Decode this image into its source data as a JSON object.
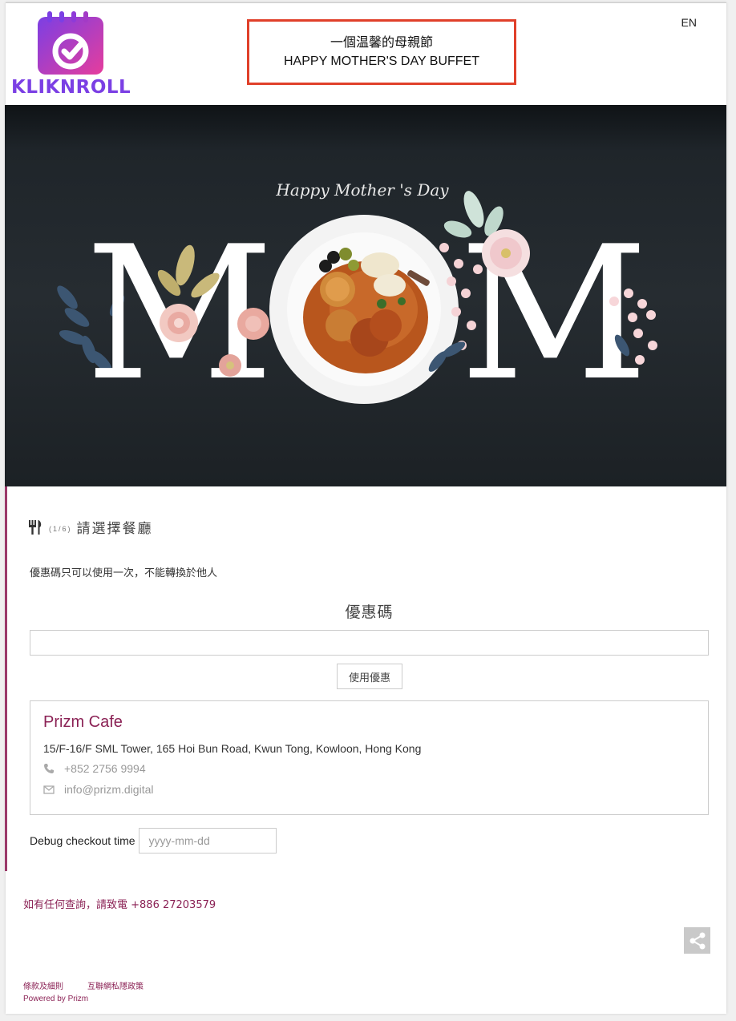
{
  "header": {
    "brand": "KLIKNROLL",
    "lang_toggle": "EN",
    "title_zh": "一個温馨的母親節",
    "title_en": "HAPPY MOTHER'S DAY BUFFET"
  },
  "banner": {
    "script_text": "Happy Mother 's Day",
    "letters": [
      "M",
      "M"
    ]
  },
  "step": {
    "counter": "(1/6)",
    "label": "請選擇餐廳"
  },
  "coupon": {
    "note": "優惠碼只可以使用一次，不能轉換於他人",
    "title": "優惠碼",
    "input_value": "",
    "apply_label": "使用優惠"
  },
  "restaurant": {
    "name": "Prizm Cafe",
    "address": "15/F-16/F SML Tower, 165 Hoi Bun Road, Kwun Tong, Kowloon, Hong Kong",
    "phone": "+852 2756 9994",
    "email": "info@prizm.digital"
  },
  "debug": {
    "label": "Debug checkout time",
    "placeholder": "yyyy-mm-dd"
  },
  "footer": {
    "contact": "如有任何查詢，請致電 +886 27203579",
    "terms": "條款及細則",
    "privacy": "互聯網私隱政策",
    "powered": "Powered by Prizm"
  },
  "icons": {
    "logo": "calendar-check-icon",
    "step": "fork-knife-icon",
    "phone": "phone-icon",
    "email": "envelope-icon",
    "share": "share-icon"
  },
  "colors": {
    "brand_accent": "#8b2255",
    "title_border": "#e0402a",
    "banner_bg": "#262c31"
  }
}
